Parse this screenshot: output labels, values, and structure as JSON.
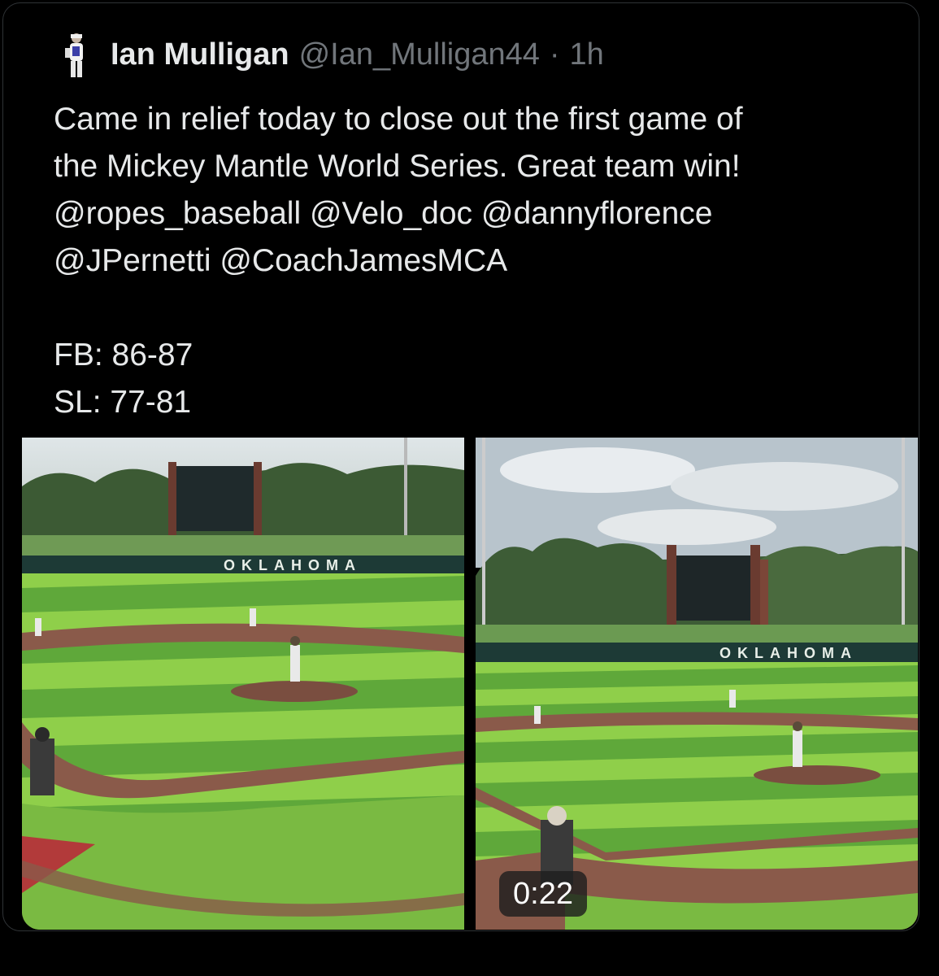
{
  "tweet": {
    "author_name": "Ian Mulligan",
    "author_handle": "@Ian_Mulligan44",
    "separator": "·",
    "timestamp": "1h",
    "text_lines": [
      "Came in relief today to close out the first game of",
      "the Mickey Mantle World Series. Great team win!",
      "@ropes_baseball @Velo_doc @dannyflorence",
      "@JPernetti @CoachJamesMCA"
    ],
    "stats": [
      "FB: 86-87",
      "SL: 77-81"
    ]
  },
  "media": {
    "left_photo_wall_text": "OKLAHOMA",
    "right_photo_wall_text": "OKLAHOMA",
    "video_duration": "0:22"
  },
  "colors": {
    "background": "#000000",
    "text_primary": "#e7e9ea",
    "text_secondary": "#71767b",
    "grass_light": "#8fcf4a",
    "grass_dark": "#5fa83a",
    "dirt": "#8a5a4a"
  }
}
